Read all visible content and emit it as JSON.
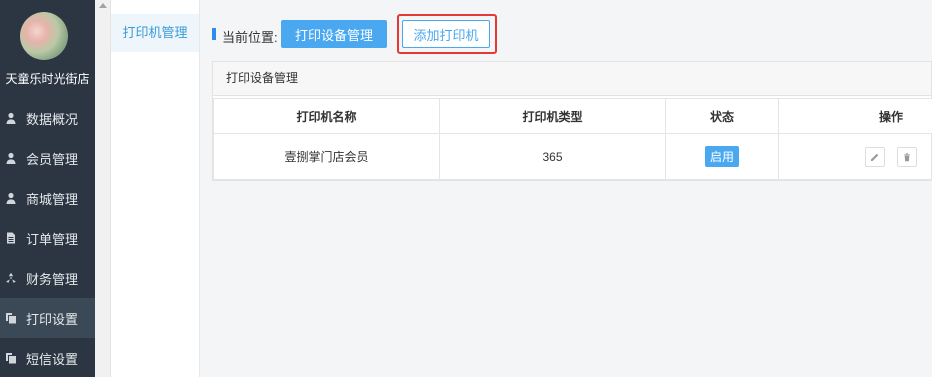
{
  "sidebar": {
    "shop_name": "天童乐时光街店",
    "items": [
      {
        "label": "数据概况",
        "icon": "user-icon"
      },
      {
        "label": "会员管理",
        "icon": "user-icon"
      },
      {
        "label": "商城管理",
        "icon": "user-icon"
      },
      {
        "label": "订单管理",
        "icon": "document-icon"
      },
      {
        "label": "财务管理",
        "icon": "recycle-icon"
      },
      {
        "label": "打印设置",
        "icon": "copy-icon",
        "active": true
      },
      {
        "label": "短信设置",
        "icon": "copy-icon"
      }
    ]
  },
  "submenu": {
    "active_label": "打印机管理"
  },
  "breadcrumb": {
    "label": "当前位置:",
    "current_button": "打印设备管理",
    "add_button": "添加打印机"
  },
  "panel": {
    "title": "打印设备管理",
    "columns": [
      "打印机名称",
      "打印机类型",
      "状态",
      "操作"
    ],
    "rows": [
      {
        "name": "壹捌掌门店会员",
        "type": "365",
        "status": "启用"
      }
    ]
  },
  "colors": {
    "accent": "#4aa8f0",
    "sidebar_bg": "#2b3642",
    "highlight": "#e53935"
  }
}
